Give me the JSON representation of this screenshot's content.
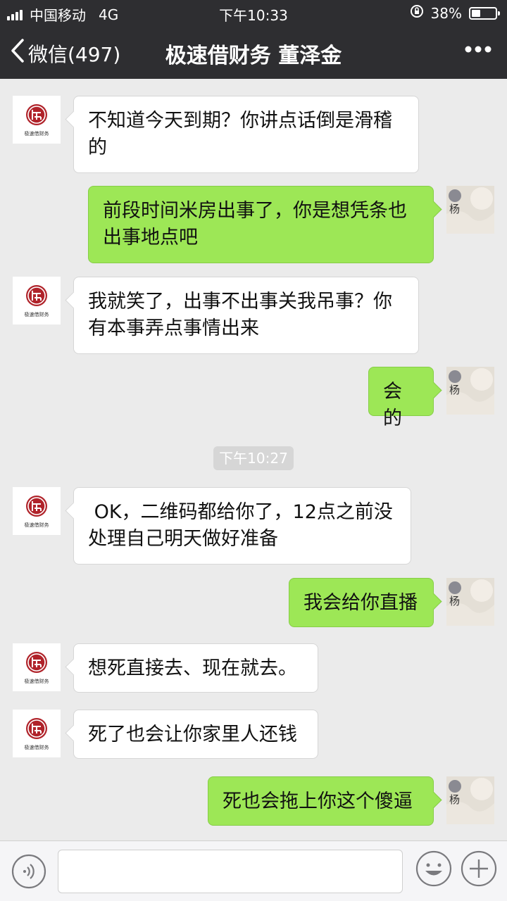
{
  "status_bar": {
    "carrier": "中国移动",
    "network": "4G",
    "time": "下午10:33",
    "battery_percent": "38%",
    "battery_level": 0.38
  },
  "nav": {
    "back_label": "微信(497)",
    "title": "极速借财务 董泽金"
  },
  "avatars": {
    "lender_caption": "极速借财务",
    "user_name": "杨"
  },
  "messages": [
    {
      "side": "left",
      "text": "不知道今天到期？你讲点话倒是滑稽\n的"
    },
    {
      "side": "right",
      "text": "前段时间米房出事了，你是想凭条也\n出事地点吧"
    },
    {
      "side": "left",
      "text": "我就笑了，出事不出事关我吊事？你\n有本事弄点事情出来"
    },
    {
      "side": "right",
      "text": "会的"
    },
    {
      "side": "left",
      "text": " OK，二维码都给你了，12点之前没\n处理自己明天做好准备"
    },
    {
      "side": "right",
      "text": "我会给你直播"
    },
    {
      "side": "left",
      "text": "想死直接去、现在就去。"
    },
    {
      "side": "left",
      "text": "死了也会让你家里人还钱"
    },
    {
      "side": "right",
      "text": "死也会拖上你这个傻逼"
    }
  ],
  "timestamp": "下午10:27",
  "colors": {
    "header_bg": "#2e2e31",
    "chat_bg": "#ebebeb",
    "sent_bubble": "#9de756",
    "received_bubble": "#ffffff",
    "brand_red": "#b0232a"
  },
  "icons": {
    "back": "chevron-left-icon",
    "more": "more-dots-icon",
    "voice": "voice-icon",
    "emoji": "emoji-icon",
    "plus": "plus-icon"
  }
}
